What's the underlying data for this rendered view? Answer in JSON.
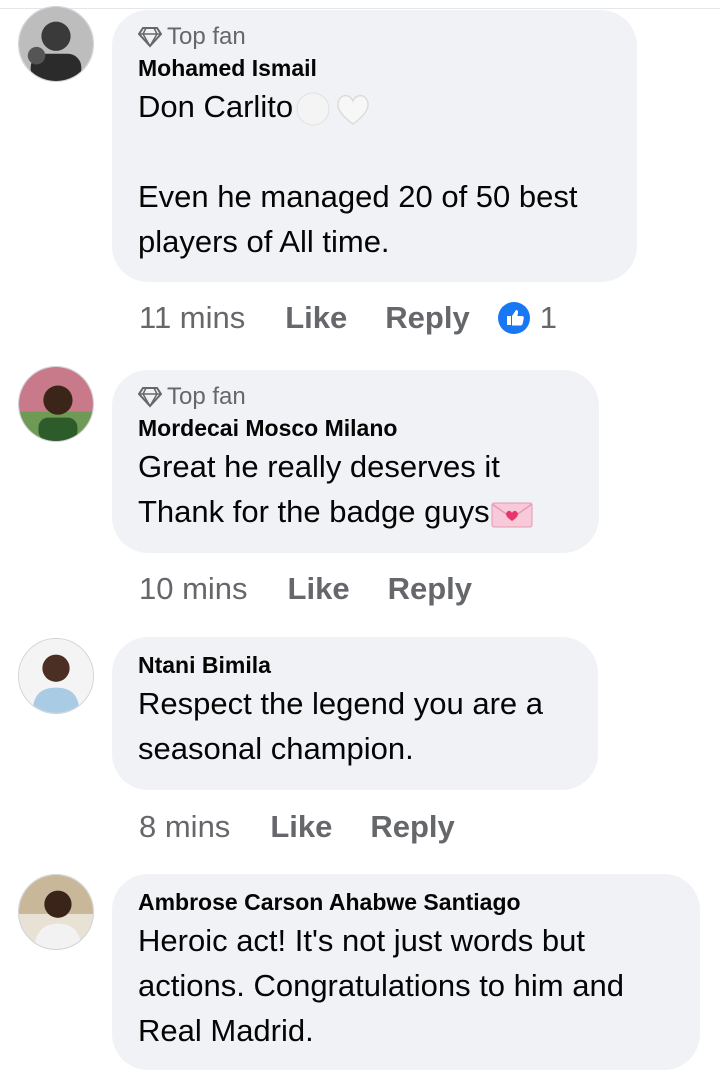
{
  "badge_label": "Top fan",
  "comments": [
    {
      "name": "Mohamed Ismail",
      "top_fan": true,
      "lines": [
        "Don Carlito",
        "",
        "Even he managed 20 of 50 best",
        "players of All time."
      ],
      "time": "11 mins",
      "like_label": "Like",
      "reply_label": "Reply",
      "reaction_count": "1"
    },
    {
      "name": "Mordecai Mosco Milano",
      "top_fan": true,
      "lines": [
        "Great he really deserves it",
        "Thank for the  badge guys"
      ],
      "time": "10 mins",
      "like_label": "Like",
      "reply_label": "Reply"
    },
    {
      "name": "Ntani Bimila",
      "top_fan": false,
      "lines": [
        "Respect the legend you are a",
        "seasonal champion."
      ],
      "time": "8 mins",
      "like_label": "Like",
      "reply_label": "Reply"
    },
    {
      "name": "Ambrose Carson Ahabwe Santiago",
      "top_fan": false,
      "lines": [
        "Heroic act! It's not just words but",
        "actions. Congratulations to him and",
        "Real Madrid."
      ]
    }
  ],
  "colors": {
    "bubble": "#f0f2f5",
    "meta_text": "#65676b",
    "like_blue": "#1877f2"
  }
}
